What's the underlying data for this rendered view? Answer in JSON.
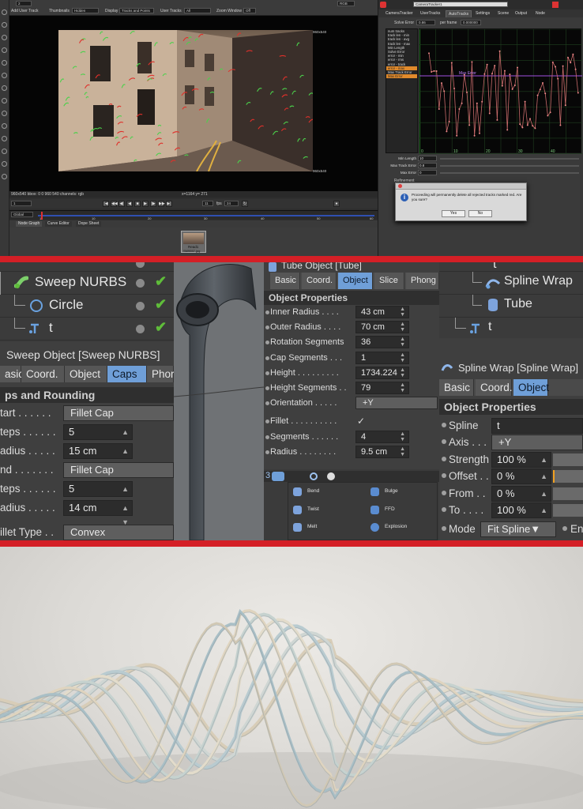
{
  "nuke": {
    "viewer_toolbar": {
      "row1_labels": [
        "2",
        "RGB"
      ],
      "row2": {
        "add_user_track": "Add User Track",
        "thumbnails_label": "Thumbnails",
        "thumbnails_value": "Hidden",
        "display_label": "Display",
        "display_value": "Tracks and Points",
        "user_tracks_label": "User Tracks",
        "user_tracks_value": "All",
        "zoom_window_label": "Zoom Window",
        "zoom_window_value": "Off"
      }
    },
    "viewer": {
      "frame_size_top": "960x540",
      "frame_size_bottom": "960x540",
      "info": "960x540 bbox: 0 0 960 540 channels: rgb",
      "coords": "x=1164 y= 271"
    },
    "transport": {
      "frame_field": "1",
      "fps_label": "fps",
      "fps_value": "24",
      "current_frame": "11"
    },
    "timeline": {
      "mode": "Global",
      "ticks": [
        "1",
        "10",
        "20",
        "30",
        "40",
        "50",
        "60"
      ]
    },
    "nodegraph_tabs": [
      "Node Graph",
      "Curve Editor",
      "Dope Sheet"
    ],
    "node_label": "Read1",
    "node_sublabel": "SM9557.jpg",
    "properties": {
      "node_name": "CameraTracker1",
      "tabs": [
        "CameraTracker",
        "UserTracks",
        "AutoTracks",
        "Settings",
        "Scene",
        "Output",
        "Node"
      ],
      "active_tab": "AutoTracks",
      "solve_error_label": "Solve Error",
      "solve_error_value": "0.86",
      "per_frame_label": "per frame",
      "per_frame_value": "0.000000",
      "track_list": [
        "num tracks",
        "track len - min",
        "track len - avg",
        "track len - max",
        "Min Length",
        "Solve Error",
        "error - min",
        "error - rms",
        "error - track",
        "error - max",
        "Max Track Error",
        "Max Error"
      ],
      "selected_track_items": [
        "error - max",
        "Max Error"
      ],
      "graph_max_error_label": "Max Error",
      "graph_ticks": [
        "0",
        "10",
        "20",
        "30",
        "40",
        "50"
      ],
      "params": [
        {
          "label": "Min Length",
          "value": "10"
        },
        {
          "label": "Max Track Error",
          "value": "0.8"
        },
        {
          "label": "Max Error",
          "value": "0"
        }
      ],
      "refinement_label": "Refinement"
    },
    "dialog": {
      "message": "Proceeding will permanently delete all rejected tracks marked red. Are you sure?",
      "yes": "Yes",
      "no": "No"
    }
  },
  "c4d": {
    "object_manager_left": [
      {
        "name": "Sweep NURBS",
        "icon": "sweep-nurbs-icon"
      },
      {
        "name": "Circle",
        "icon": "circle-spline-icon"
      },
      {
        "name": "t",
        "icon": "text-spline-icon"
      }
    ],
    "sweep_am": {
      "title": "Sweep Object [Sweep NURBS]",
      "tabs": [
        "asic",
        "Coord.",
        "Object",
        "Caps",
        "Phor"
      ],
      "active_tab": "Caps",
      "section": "ps and Rounding",
      "rows": [
        {
          "label": "tart . . . . . .",
          "value": "Fillet Cap",
          "type": "button"
        },
        {
          "label": "teps . . . . . .",
          "value": "5",
          "type": "field"
        },
        {
          "label": "adius . . . . .",
          "value": "15 cm",
          "type": "field"
        },
        {
          "label": "nd . . . . . . .",
          "value": "Fillet Cap",
          "type": "button"
        },
        {
          "label": "teps . . . . . .",
          "value": "5",
          "type": "field"
        },
        {
          "label": "adius . . . . .",
          "value": "14 cm",
          "type": "field"
        },
        {
          "label": "illet Type . .",
          "value": "Convex",
          "type": "button"
        }
      ]
    },
    "tube_am": {
      "title": "Tube Object [Tube]",
      "tabs": [
        "Basic",
        "Coord.",
        "Object",
        "Slice",
        "Phong"
      ],
      "active_tab": "Object",
      "section": "Object Properties",
      "rows": [
        {
          "label": "Inner Radius . . . .",
          "value": "43 cm"
        },
        {
          "label": "Outer Radius . . . .",
          "value": "70 cm"
        },
        {
          "label": "Rotation Segments",
          "value": "36"
        },
        {
          "label": "Cap Segments . . .",
          "value": "1"
        },
        {
          "label": "Height . . . . . . . . .",
          "value": "1734.224"
        },
        {
          "label": "Height Segments . .",
          "value": "79"
        },
        {
          "label": "Orientation . . . . .",
          "value": "+Y"
        },
        {
          "label": "Fillet . . . . . . . . . .",
          "value": "✓"
        },
        {
          "label": "Segments . . . . . .",
          "value": "4"
        },
        {
          "label": "Radius . . . . . . . .",
          "value": "9.5 cm"
        }
      ]
    },
    "deformers": [
      {
        "name": "Bend",
        "icon": "bend-icon"
      },
      {
        "name": "Bulge",
        "icon": "bulge-icon"
      },
      {
        "name": "Twist",
        "icon": "twist-icon"
      },
      {
        "name": "FFD",
        "icon": "ffd-icon"
      },
      {
        "name": "Melt",
        "icon": "melt-icon"
      },
      {
        "name": "Explosion",
        "icon": "explosion-icon"
      }
    ],
    "object_manager_right": [
      {
        "name": "t",
        "icon": "text-spline-icon"
      },
      {
        "name": "Spline Wrap",
        "icon": "spline-wrap-icon"
      },
      {
        "name": "Tube",
        "icon": "tube-icon"
      },
      {
        "name": "t",
        "icon": "text-spline-icon"
      }
    ],
    "splinewrap_am": {
      "title": "Spline Wrap [Spline Wrap]",
      "tabs": [
        "Basic",
        "Coord.",
        "Object"
      ],
      "active_tab": "Object",
      "section": "Object Properties",
      "rows": [
        {
          "label": "Spline",
          "value": "t"
        },
        {
          "label": "Axis . . .",
          "value": "+Y"
        },
        {
          "label": "Strength",
          "value": "100 %"
        },
        {
          "label": "Offset . .",
          "value": "0 %"
        },
        {
          "label": "From . .",
          "value": "0 %"
        },
        {
          "label": "To . . . .",
          "value": "100 %"
        },
        {
          "label": "Mode",
          "value": "Fit Spline"
        }
      ],
      "mode_trailing": "En"
    }
  },
  "colors": {
    "separator": "#d41f26",
    "c4d_active_tab": "#6f9fd8",
    "c4d_check": "#5fbd3a",
    "nuke_track_green": "#4bd14b",
    "nuke_track_red": "#e0302a",
    "nuke_selected": "#e08a2c"
  }
}
